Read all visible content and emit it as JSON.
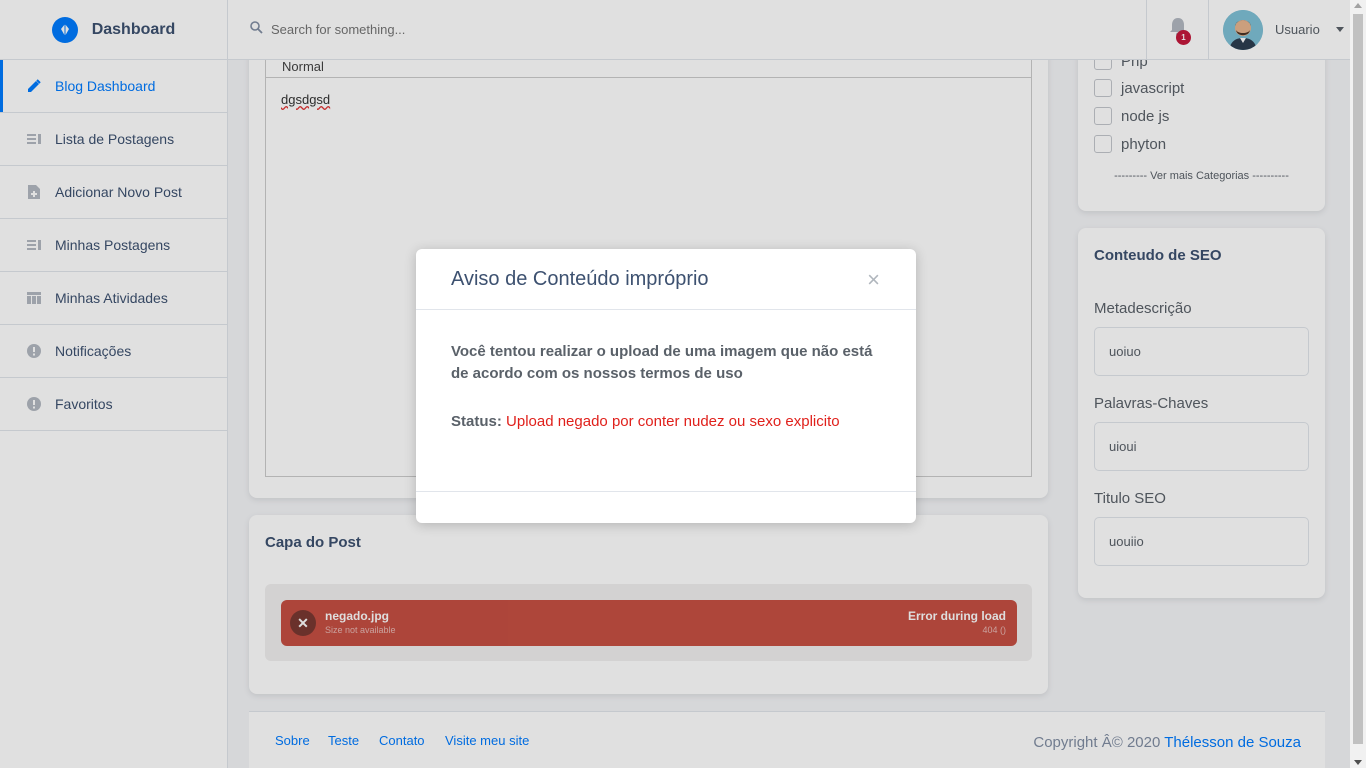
{
  "brand": {
    "title": "Dashboard"
  },
  "sidebar": {
    "items": [
      {
        "label": "Blog Dashboard",
        "icon": "pencil-icon",
        "active": true
      },
      {
        "label": "Lista de Postagens",
        "icon": "list-icon"
      },
      {
        "label": "Adicionar Novo Post",
        "icon": "note-add-icon"
      },
      {
        "label": "Minhas Postagens",
        "icon": "list-icon"
      },
      {
        "label": "Minhas Atividades",
        "icon": "table-icon"
      },
      {
        "label": "Notificações",
        "icon": "info-icon"
      },
      {
        "label": "Favoritos",
        "icon": "info-icon"
      }
    ]
  },
  "topbar": {
    "search_placeholder": "Search for something...",
    "notification_count": "1",
    "user_name": "Usuario"
  },
  "editor": {
    "toolbar_format": "Normal",
    "content": "dgsdgsd"
  },
  "cover": {
    "title": "Capa do Post",
    "file_name": "negado.jpg",
    "file_size": "Size not available",
    "status": "Error during load",
    "status_detail": "404 ()"
  },
  "categories": {
    "items": [
      "Php",
      "javascript",
      "node js",
      "phyton"
    ],
    "more_label": "--------- Ver mais Categorias ----------"
  },
  "seo": {
    "title": "Conteudo de SEO",
    "meta_label": "Metadescrição",
    "meta_value": "uoiuo",
    "keywords_label": "Palavras-Chaves",
    "keywords_value": "uioui",
    "seo_title_label": "Titulo SEO",
    "seo_title_value": "uouiio"
  },
  "footer": {
    "links": [
      "Sobre",
      "Teste",
      "Contato",
      "Visite meu site"
    ],
    "copyright_prefix": "Copyright Â© 2020",
    "copyright_author": "Thélesson de Souza"
  },
  "modal": {
    "title": "Aviso de Conteúdo impróprio",
    "close": "×",
    "message": "Você tentou realizar o upload de uma imagem que não está de acordo com os nossos termos de uso",
    "status_label": "Status:",
    "status_value": "Upload negado por conter nudez ou sexo explicito"
  },
  "colors": {
    "accent": "#007bff",
    "error": "#c0392b",
    "badge": "#c4183c"
  }
}
